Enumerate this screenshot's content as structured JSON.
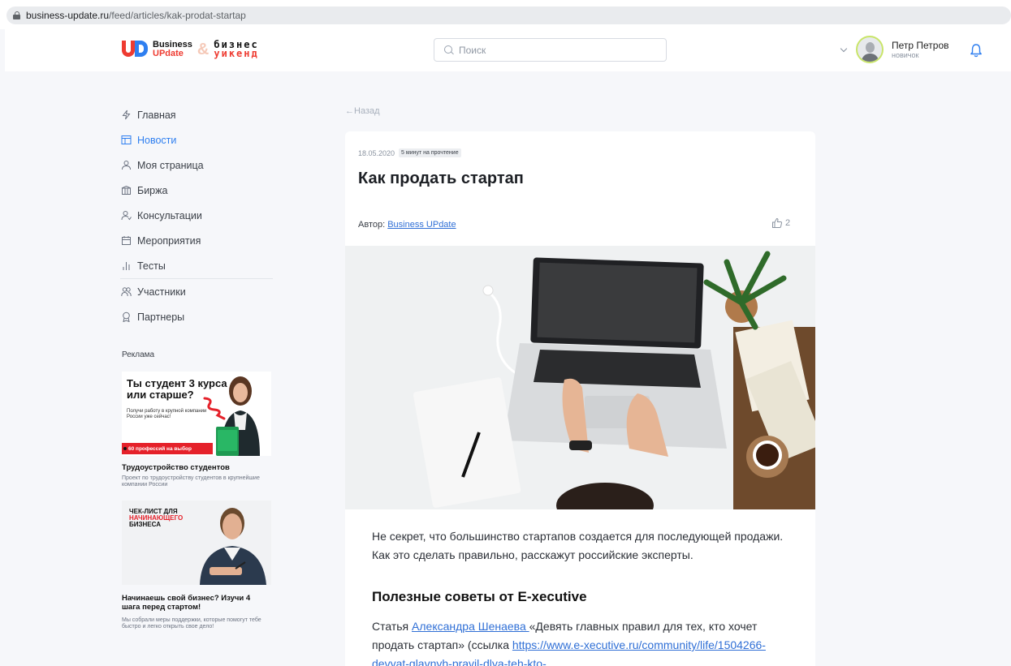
{
  "browser": {
    "url_host": "business-update.ru",
    "url_path": "/feed/articles/kak-prodat-startap"
  },
  "header": {
    "logo": {
      "line1": "Business",
      "line2": "UPdate",
      "amp": "&",
      "alt1": "бизнес",
      "alt2": "уикенд"
    },
    "search_placeholder": "Поиск",
    "user": {
      "name": "Петр Петров",
      "rank": "новичок"
    }
  },
  "sidebar": {
    "items": [
      {
        "label": "Главная",
        "icon": "lightning-icon",
        "active": false
      },
      {
        "label": "Новости",
        "icon": "news-icon",
        "active": true
      },
      {
        "label": "Моя страница",
        "icon": "user-icon",
        "active": false
      },
      {
        "label": "Биржа",
        "icon": "exchange-icon",
        "active": false
      },
      {
        "label": "Консультации",
        "icon": "consult-icon",
        "active": false
      },
      {
        "label": "Мероприятия",
        "icon": "calendar-icon",
        "active": false
      },
      {
        "label": "Тесты",
        "icon": "bars-icon",
        "active": false
      },
      {
        "label": "Участники",
        "icon": "users-icon",
        "active": false
      },
      {
        "label": "Партнеры",
        "icon": "award-icon",
        "active": false
      }
    ]
  },
  "ads": {
    "title": "Реклама",
    "ad1": {
      "headline": "Ты студент 3 курса или старше?",
      "sub": "Получи работу в крупной компании России уже сейчас!",
      "bar": "60 профессий на выбор",
      "caption": "Трудоустройство студентов",
      "desc": "Проект по трудоустройству студентов в крупнейшие компании России"
    },
    "ad2": {
      "line1": "ЧЕК-ЛИСТ ДЛЯ",
      "line2": "НАЧИНАЮЩЕГО",
      "line3": "БИЗНЕСА",
      "caption": "Начинаешь свой бизнес? Изучи 4 шага перед стартом!",
      "desc": "Мы собрали меры поддержки, которые помогут тебе быстро и легко открыть свое дело!"
    }
  },
  "article": {
    "back": "←Назад",
    "date": "18.05.2020",
    "read_time": "5 минут на прочтение",
    "title": "Как продать стартап",
    "author_label": "Автор:",
    "author_name": "Business UPdate",
    "likes": "2",
    "lead": "Не секрет, что большинство стартапов создается для последующей продажи. Как это сделать правильно, расскажут российские эксперты.",
    "h2": "Полезные советы от E-xecutive",
    "p2_start": "Статья ",
    "p2_link_author": "Александра Шенаева ",
    "p2_mid": "«Девять главных правил для тех, кто хочет продать стартап» (ссылка ",
    "p2_link_url": "https://www.e-xecutive.ru/community/life/1504266-devyat-glavnyh-pravil-dlya-teh-kto-"
  },
  "colors": {
    "accent": "#2f7ff0",
    "brand_red": "#ee3b31",
    "background": "#f6f7fa"
  }
}
